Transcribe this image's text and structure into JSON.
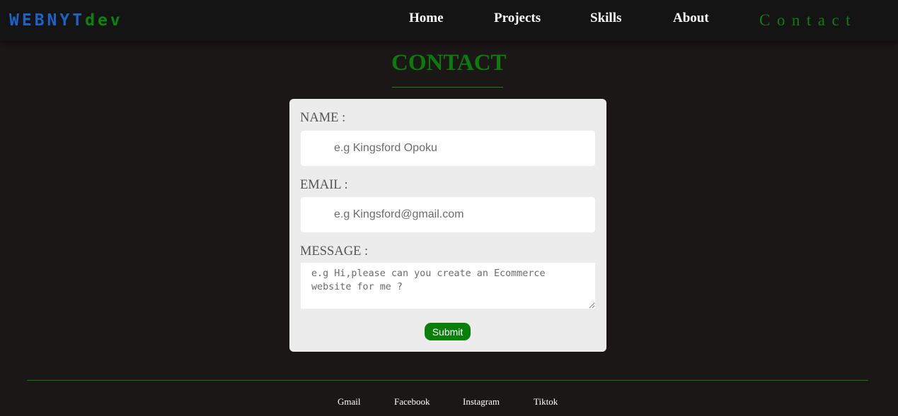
{
  "brand": {
    "part1": "WEBNYT",
    "part2": "dev"
  },
  "nav": {
    "home": "Home",
    "projects": "Projects",
    "skills": "Skills",
    "about": "About",
    "contact": "Contact"
  },
  "page_title": "CONTACT",
  "form": {
    "name_label": "NAME :",
    "name_placeholder": "e.g Kingsford Opoku",
    "email_label": "EMAIL :",
    "email_placeholder": "e.g Kingsford@gmail.com",
    "message_label": "MESSAGE :",
    "message_placeholder": "e.g Hi,please can you create an Ecommerce website for me ?",
    "submit_label": "Submit"
  },
  "footer": {
    "links": [
      "Gmail",
      "Facebook",
      "Instagram",
      "Tiktok"
    ]
  },
  "colors": {
    "background": "#1c1717",
    "navbar": "#151414",
    "brand_blue": "#1d63c7",
    "accent_green": "#0b7c0b",
    "card": "#ececec"
  }
}
